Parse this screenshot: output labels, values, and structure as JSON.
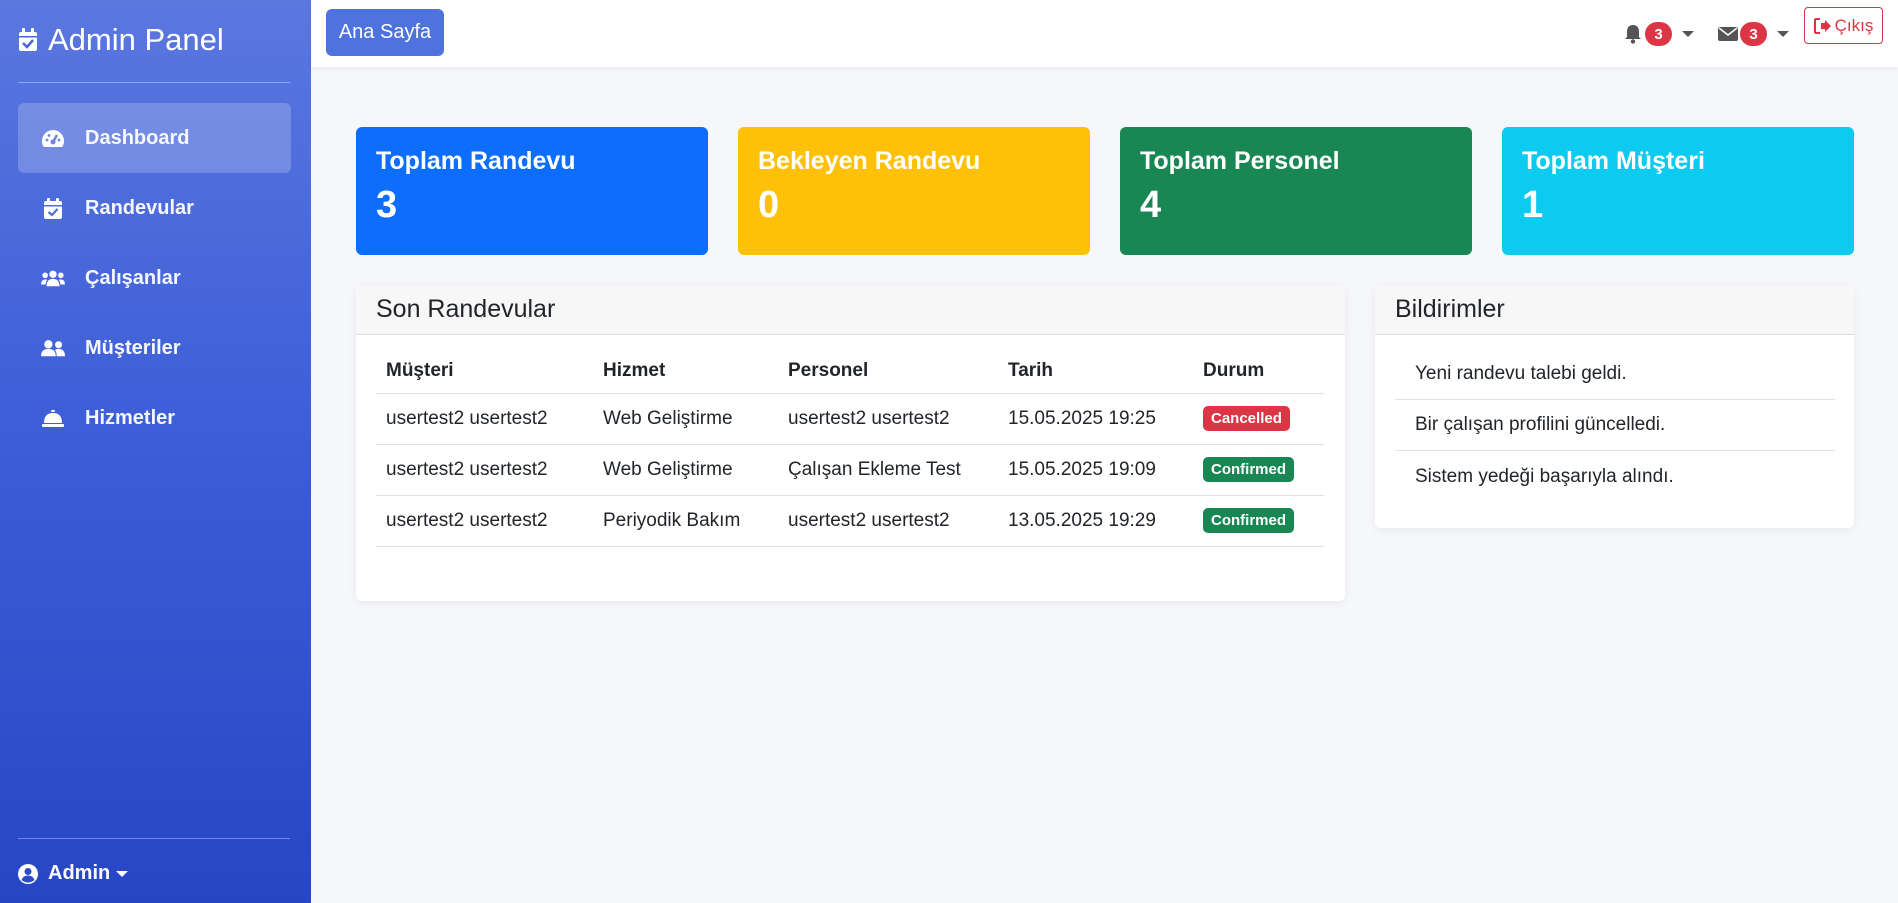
{
  "sidebar": {
    "brand": "Admin Panel",
    "items": [
      {
        "label": "Dashboard",
        "icon": "gauge-icon",
        "active": true
      },
      {
        "label": "Randevular",
        "icon": "calendar-check-icon"
      },
      {
        "label": "Çalışanlar",
        "icon": "users-icon"
      },
      {
        "label": "Müşteriler",
        "icon": "user-friends-icon"
      },
      {
        "label": "Hizmetler",
        "icon": "concierge-bell-icon"
      }
    ],
    "user": "Admin"
  },
  "topbar": {
    "home_label": "Ana Sayfa",
    "notifications_count": "3",
    "messages_count": "3",
    "logout_label": "Çıkış"
  },
  "stats": [
    {
      "title": "Toplam Randevu",
      "value": "3",
      "color": "#0d6efd"
    },
    {
      "title": "Bekleyen Randevu",
      "value": "0",
      "color": "#ffc107"
    },
    {
      "title": "Toplam Personel",
      "value": "4",
      "color": "#198754"
    },
    {
      "title": "Toplam Müşteri",
      "value": "1",
      "color": "#0dcaf0"
    }
  ],
  "appointments": {
    "title": "Son Randevular",
    "columns": [
      "Müşteri",
      "Hizmet",
      "Personel",
      "Tarih",
      "Durum"
    ],
    "rows": [
      {
        "customer": "usertest2 usertest2",
        "service": "Web Geliştirme",
        "staff": "usertest2 usertest2",
        "date": "15.05.2025 19:25",
        "status": "Cancelled",
        "status_color": "#dc3545"
      },
      {
        "customer": "usertest2 usertest2",
        "service": "Web Geliştirme",
        "staff": "Çalışan Ekleme Test",
        "date": "15.05.2025 19:09",
        "status": "Confirmed",
        "status_color": "#198754"
      },
      {
        "customer": "usertest2 usertest2",
        "service": "Periyodik Bakım",
        "staff": "usertest2 usertest2",
        "date": "13.05.2025 19:29",
        "status": "Confirmed",
        "status_color": "#198754"
      }
    ]
  },
  "notifications": {
    "title": "Bildirimler",
    "items": [
      "Yeni randevu talebi geldi.",
      "Bir çalışan profilini güncelledi.",
      "Sistem yedeği başarıyla alındı."
    ]
  }
}
